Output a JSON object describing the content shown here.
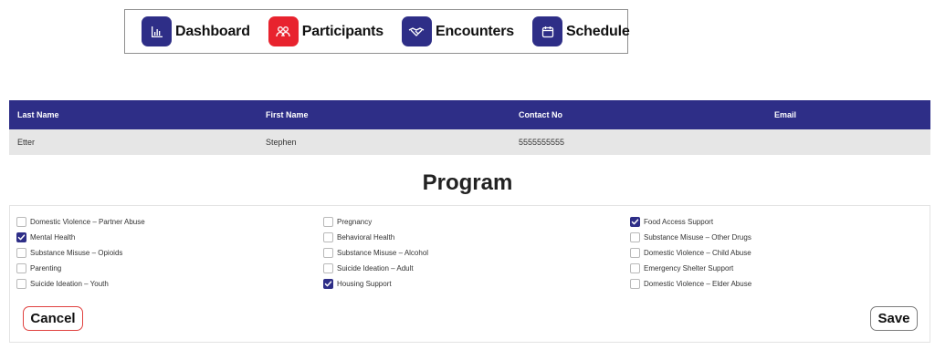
{
  "nav": {
    "items": [
      {
        "label": "Dashboard",
        "icon": "chart-icon",
        "color": "#2e2e87"
      },
      {
        "label": "Participants",
        "icon": "people-icon",
        "color": "#e8232e"
      },
      {
        "label": "Encounters",
        "icon": "handshake-icon",
        "color": "#2e2e87"
      },
      {
        "label": "Schedule",
        "icon": "calendar-icon",
        "color": "#2e2e87"
      }
    ]
  },
  "table": {
    "headers": [
      "Last Name",
      "First Name",
      "Contact No",
      "Email"
    ],
    "rows": [
      [
        "Etter",
        "Stephen",
        "5555555555",
        ""
      ]
    ]
  },
  "program": {
    "title": "Program",
    "options": [
      {
        "label": "Domestic Violence – Partner Abuse",
        "checked": false
      },
      {
        "label": "Mental Health",
        "checked": true
      },
      {
        "label": "Substance Misuse – Opioids",
        "checked": false
      },
      {
        "label": "Parenting",
        "checked": false
      },
      {
        "label": "Suicide Ideation – Youth",
        "checked": false
      },
      {
        "label": "Pregnancy",
        "checked": false
      },
      {
        "label": "Behavioral Health",
        "checked": false
      },
      {
        "label": "Substance Misuse – Alcohol",
        "checked": false
      },
      {
        "label": "Suicide Ideation – Adult",
        "checked": false
      },
      {
        "label": "Housing Support",
        "checked": true
      },
      {
        "label": "Food Access Support",
        "checked": true
      },
      {
        "label": "Substance Misuse – Other Drugs",
        "checked": false
      },
      {
        "label": "Domestic Violence – Child Abuse",
        "checked": false
      },
      {
        "label": "Emergency Shelter Support",
        "checked": false
      },
      {
        "label": "Domestic Violence – Elder Abuse",
        "checked": false
      }
    ]
  },
  "actions": {
    "cancel_label": "Cancel",
    "save_label": "Save"
  },
  "colors": {
    "primary": "#2e2e87",
    "accent": "#e8232e"
  }
}
